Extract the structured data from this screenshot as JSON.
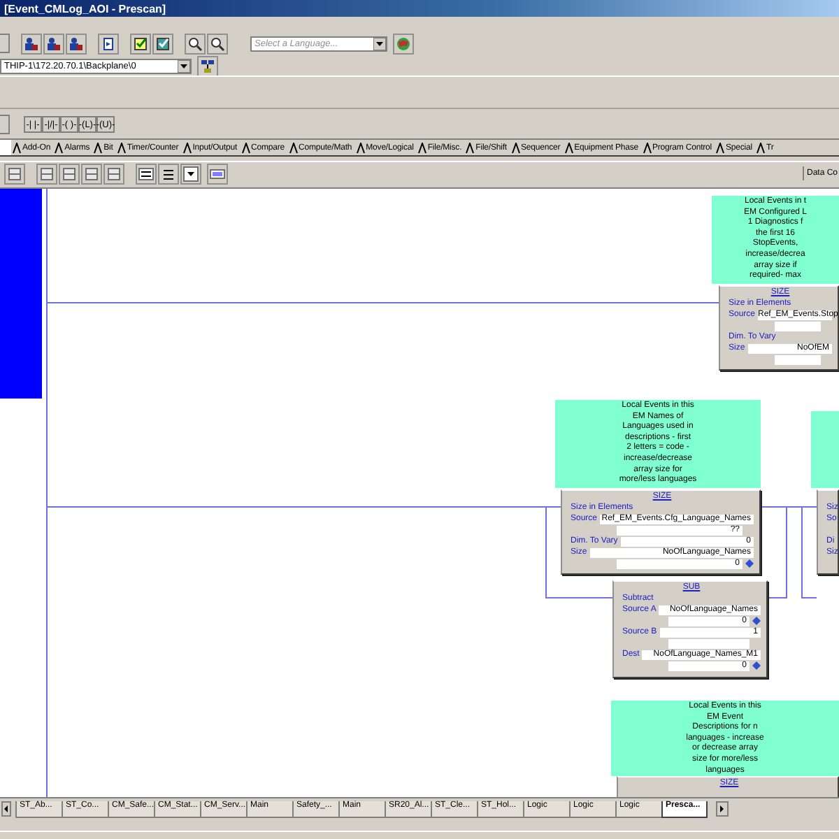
{
  "window": {
    "title": "[Event_CMLog_AOI - Prescan]"
  },
  "toolbar": {
    "language_placeholder": "Select a Language...",
    "path": "THIP-1\\172.20.70.1\\Backplane\\0"
  },
  "instruction_buttons": [
    "-| |-",
    "-|/|-",
    "-( )-",
    "-(L)-",
    "-(U)-"
  ],
  "instruction_tabs": [
    "Add-On",
    "Alarms",
    "Bit",
    "Timer/Counter",
    "Input/Output",
    "Compare",
    "Compute/Math",
    "Move/Logical",
    "File/Misc.",
    "File/Shift",
    "Sequencer",
    "Equipment Phase",
    "Program Control",
    "Special",
    "Tr"
  ],
  "data_context_label": "Data Co",
  "ladder": {
    "comments": [
      {
        "lines": [
          "Local Events in t",
          "EM Configured L",
          "1 Diagnostics f",
          "the first 16",
          "StopEvents,",
          "increase/decrea",
          "array size if",
          "required- max"
        ]
      },
      {
        "lines": [
          "Local Events in this",
          "EM Names of",
          "Languages used in",
          "descriptions - first",
          "2 letters = code -",
          "increase/decrease",
          "array size for",
          "more/less languages"
        ]
      },
      {
        "lines": [
          "Local Events in this",
          "EM Event",
          "Descriptions for n",
          "languages - increase",
          "or decrease array",
          "size for more/less",
          "languages"
        ]
      }
    ],
    "instructions": [
      {
        "title": "SIZE",
        "rows": [
          {
            "kind": "header",
            "label": "Size in Elements"
          },
          {
            "kind": "operand",
            "label": "Source",
            "value": "Ref_EM_Events.Stop"
          },
          {
            "kind": "blank"
          },
          {
            "kind": "operand_empty",
            "label": "Dim. To Vary"
          },
          {
            "kind": "operand",
            "label": "Size",
            "value": "NoOfEM"
          },
          {
            "kind": "blank"
          }
        ]
      },
      {
        "title": "SIZE",
        "rows": [
          {
            "kind": "header",
            "label": "Size in Elements"
          },
          {
            "kind": "operand",
            "label": "Source",
            "value": "Ref_EM_Events.Cfg_Language_Names"
          },
          {
            "kind": "value",
            "value": "??",
            "marker": false
          },
          {
            "kind": "operand",
            "label": "Dim. To Vary",
            "value": "0"
          },
          {
            "kind": "operand",
            "label": "Size",
            "value": "NoOfLanguage_Names"
          },
          {
            "kind": "value",
            "value": "0",
            "marker": true
          }
        ]
      },
      {
        "title": "SUB",
        "rows": [
          {
            "kind": "header",
            "label": "Subtract"
          },
          {
            "kind": "operand",
            "label": "Source A",
            "value": "NoOfLanguage_Names"
          },
          {
            "kind": "value",
            "value": "0",
            "marker": true
          },
          {
            "kind": "operand",
            "label": "Source B",
            "value": "1"
          },
          {
            "kind": "blank"
          },
          {
            "kind": "operand",
            "label": "Dest",
            "value": "NoOfLanguage_Names_M1"
          },
          {
            "kind": "value",
            "value": "0",
            "marker": true
          }
        ]
      },
      {
        "rows": [
          {
            "kind": "header",
            "label": "Siz"
          },
          {
            "kind": "header",
            "label": "So"
          },
          {
            "kind": "blank"
          },
          {
            "kind": "header",
            "label": "Di"
          },
          {
            "kind": "header",
            "label": "Siz"
          },
          {
            "kind": "blank"
          }
        ]
      },
      {
        "title": "SIZE"
      }
    ]
  },
  "routine_tabs": [
    {
      "label": "ST_Ab...",
      "selected": false
    },
    {
      "label": "ST_Co...",
      "selected": false
    },
    {
      "label": "CM_Safe...",
      "selected": false
    },
    {
      "label": "CM_Stat...",
      "selected": false
    },
    {
      "label": "CM_Serv...",
      "selected": false
    },
    {
      "label": "Main",
      "selected": false
    },
    {
      "label": "Safety_...",
      "selected": false
    },
    {
      "label": "Main",
      "selected": false
    },
    {
      "label": "SR20_Al...",
      "selected": false
    },
    {
      "label": "ST_Cle...",
      "selected": false
    },
    {
      "label": "ST_Hol...",
      "selected": false
    },
    {
      "label": "Logic",
      "selected": false
    },
    {
      "label": "Logic",
      "selected": false
    },
    {
      "label": "Logic",
      "selected": false
    },
    {
      "label": "Presca...",
      "selected": true
    }
  ]
}
